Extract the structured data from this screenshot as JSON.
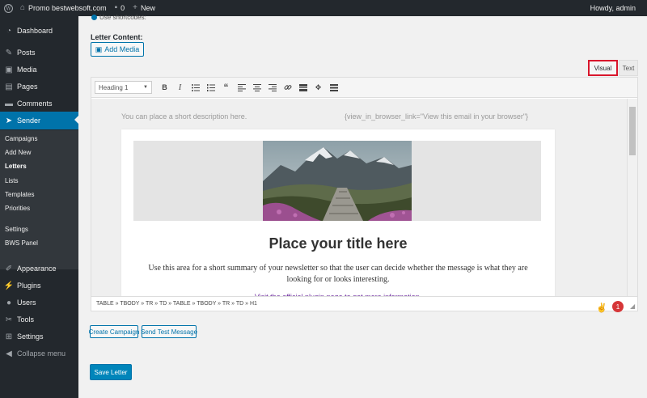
{
  "adminbar": {
    "site_name": "Promo bestwebsoft.com",
    "comments_count": "0",
    "new_label": "New",
    "greeting": "Howdy, admin"
  },
  "sidebar": {
    "menu": [
      {
        "label": "Dashboard",
        "icon": "gauge-icon"
      },
      {
        "label": "Posts",
        "icon": "pin-icon"
      },
      {
        "label": "Media",
        "icon": "media-icon"
      },
      {
        "label": "Pages",
        "icon": "page-icon"
      },
      {
        "label": "Comments",
        "icon": "comment-icon"
      },
      {
        "label": "Sender",
        "icon": "send-icon"
      },
      {
        "label": "Appearance",
        "icon": "brush-icon"
      },
      {
        "label": "Plugins",
        "icon": "plug-icon"
      },
      {
        "label": "Users",
        "icon": "user-icon"
      },
      {
        "label": "Tools",
        "icon": "wrench-icon"
      },
      {
        "label": "Settings",
        "icon": "settings-icon"
      },
      {
        "label": "Collapse menu",
        "icon": "collapse-icon"
      }
    ],
    "submenu": [
      "Campaigns",
      "Add New",
      "Letters",
      "Lists",
      "Templates",
      "Priorities",
      "Settings",
      "BWS Panel"
    ]
  },
  "main": {
    "hint": "Use shortcodes:",
    "section_label": "Letter Content:",
    "add_media": "Add Media",
    "tabs": {
      "visual": "Visual",
      "text": "Text"
    },
    "format_select": "Heading 1",
    "preheader_left": "You can place a short description here.",
    "preheader_right": "{view_in_browser_link=\"View this email in your browser\"}",
    "email_title": "Place your title here",
    "email_desc": "Use this area for a short summary of your newsletter so that the user can decide whether the message is what they are looking for or looks interesting.",
    "email_link": "Visit the official plugin page to get more information.",
    "path": "TABLE » TBODY » TR » TD » TABLE » TBODY » TR » TD » H1",
    "notification_count": "1",
    "buttons": {
      "create_campaign": "Create Campaign",
      "send_test": "Send Test Message",
      "save_letter": "Save Letter"
    }
  },
  "colors": {
    "admin_bg": "#23282d",
    "accent": "#0073aa",
    "highlight_border": "#d9162c"
  }
}
